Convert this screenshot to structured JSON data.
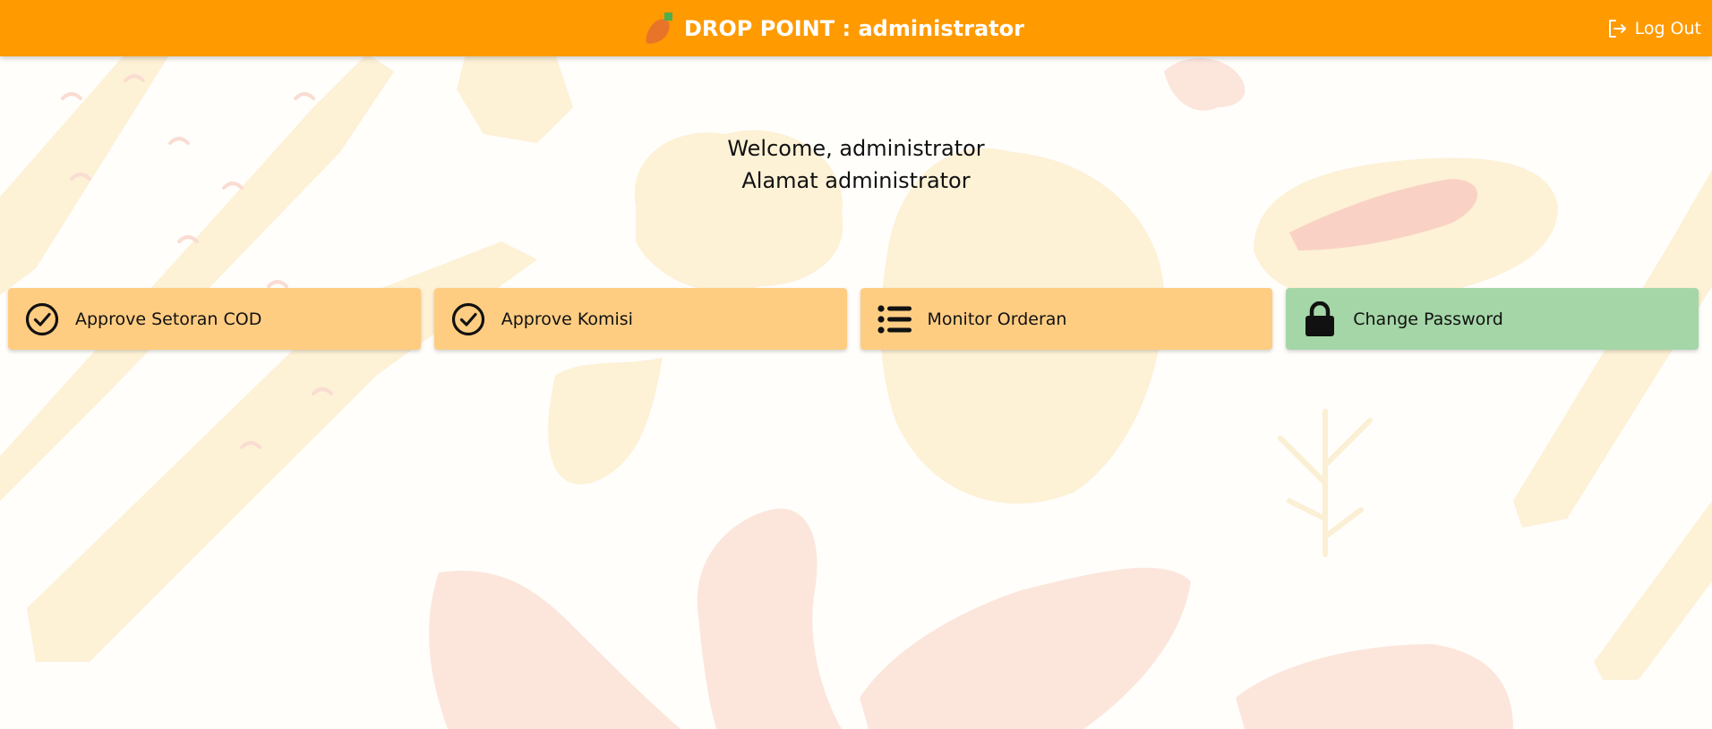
{
  "header": {
    "title": "DROP POINT : administrator",
    "logout_label": "Log Out",
    "background_color": "#ff9a00"
  },
  "welcome": {
    "line1": "Welcome, administrator",
    "line2": "Alamat administrator"
  },
  "actions": [
    {
      "label": "Approve Setoran COD",
      "icon": "check-circle-icon",
      "color": "#ffcd82"
    },
    {
      "label": "Approve Komisi",
      "icon": "check-circle-icon",
      "color": "#ffcd82"
    },
    {
      "label": "Monitor Orderan",
      "icon": "list-icon",
      "color": "#ffcd82"
    },
    {
      "label": "Change Password",
      "icon": "lock-icon",
      "color": "#a5d6a7"
    }
  ]
}
